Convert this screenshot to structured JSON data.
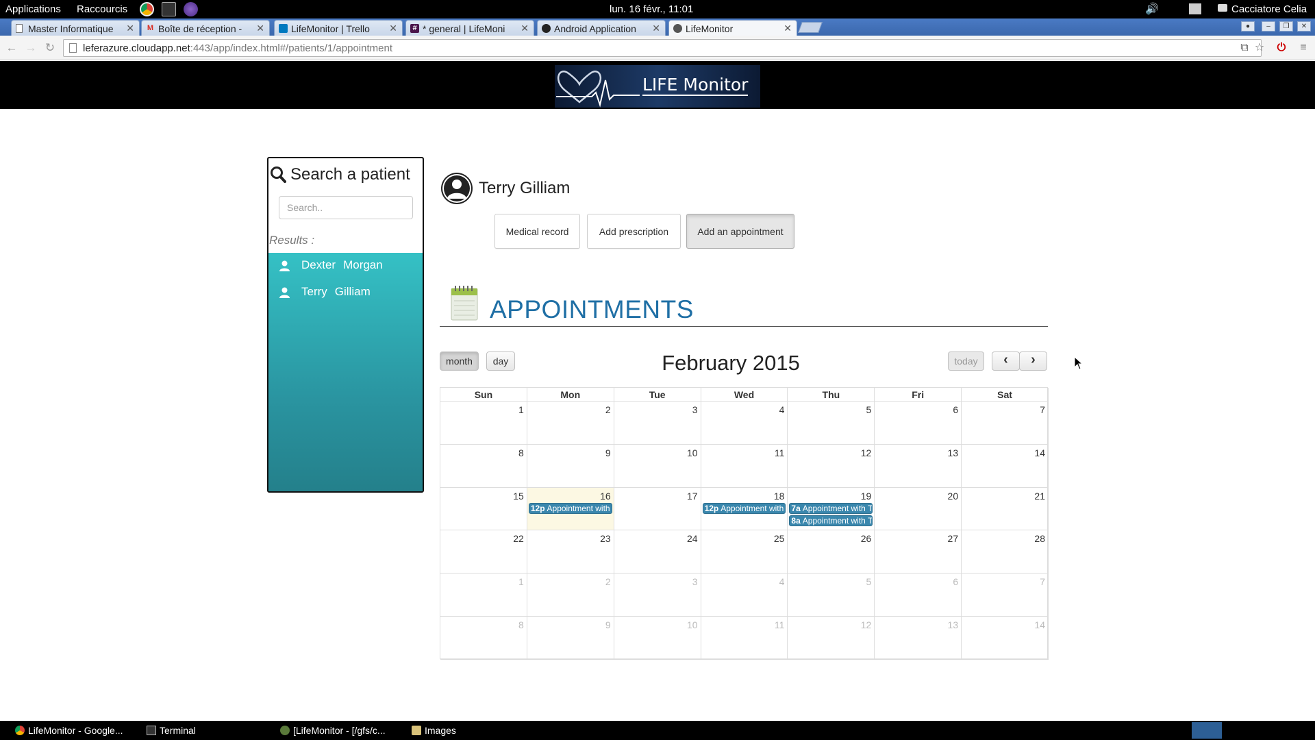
{
  "topbar": {
    "applications": "Applications",
    "shortcuts": "Raccourcis",
    "clock": "lun. 16 févr., 11:01",
    "user": "Cacciatore Celia"
  },
  "browser": {
    "tabs": [
      {
        "label": "Master Informatique",
        "favicon": "doc-icon"
      },
      {
        "label": "Boîte de réception -",
        "favicon": "gmail-icon"
      },
      {
        "label": "LifeMonitor | Trello",
        "favicon": "trello-icon"
      },
      {
        "label": "* general | LifeMoni",
        "favicon": "slack-icon"
      },
      {
        "label": "Android Application",
        "favicon": "github-icon"
      },
      {
        "label": "LifeMonitor",
        "favicon": "lifemonitor-icon"
      }
    ],
    "url_host": "leferazure.cloudapp.net",
    "url_rest": ":443/app/index.html#/patients/1/appointment"
  },
  "site": {
    "logo_text": "LIFE Monitor"
  },
  "sidebar": {
    "title": "Search a patient",
    "search_placeholder": "Search..",
    "results_label": "Results :",
    "results": [
      {
        "first": "Dexter",
        "last": "Morgan"
      },
      {
        "first": "Terry",
        "last": "Gilliam"
      }
    ]
  },
  "patient": {
    "name": "Terry Gilliam",
    "actions": {
      "medical_record": "Medical record",
      "add_prescription": "Add prescription",
      "add_appointment": "Add an appointment"
    }
  },
  "appointments": {
    "heading": "APPOINTMENTS",
    "calendar": {
      "title": "February 2015",
      "view_month": "month",
      "view_day": "day",
      "today": "today",
      "prev": "‹",
      "next": "›",
      "days_of_week": [
        "Sun",
        "Mon",
        "Tue",
        "Wed",
        "Thu",
        "Fri",
        "Sat"
      ],
      "weeks": [
        [
          1,
          2,
          3,
          4,
          5,
          6,
          7
        ],
        [
          8,
          9,
          10,
          11,
          12,
          13,
          14
        ],
        [
          15,
          16,
          17,
          18,
          19,
          20,
          21
        ],
        [
          22,
          23,
          24,
          25,
          26,
          27,
          28
        ],
        [
          1,
          2,
          3,
          4,
          5,
          6,
          7
        ],
        [
          8,
          9,
          10,
          11,
          12,
          13,
          14
        ]
      ],
      "today_date": 16,
      "events": [
        {
          "day": 16,
          "time": "12p",
          "title": "Appointment with"
        },
        {
          "day": 18,
          "time": "12p",
          "title": "Appointment with"
        },
        {
          "day": 19,
          "time": "7a",
          "title": "Appointment with T"
        },
        {
          "day": 19,
          "time": "8a",
          "title": "Appointment with T"
        }
      ]
    }
  },
  "taskbar": {
    "items": [
      {
        "label": "LifeMonitor - Google..."
      },
      {
        "label": "Terminal"
      },
      {
        "label": "[LifeMonitor - [/gfs/c..."
      },
      {
        "label": "Images"
      }
    ]
  }
}
